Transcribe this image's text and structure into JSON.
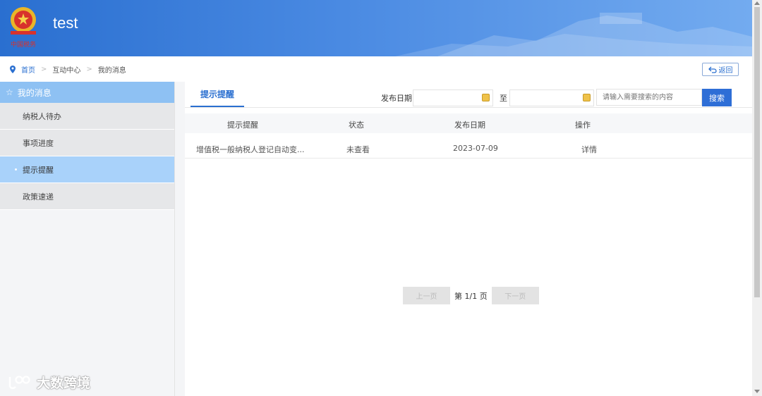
{
  "header": {
    "title": "test"
  },
  "breadcrumb": {
    "home": "首页",
    "level2": "互动中心",
    "current": "我的消息",
    "back_label": "返回"
  },
  "sidebar": {
    "title": "我的消息",
    "items": [
      {
        "label": "纳税人待办"
      },
      {
        "label": "事项进度"
      },
      {
        "label": "提示提醒"
      },
      {
        "label": "政策速递"
      }
    ]
  },
  "main": {
    "tab": "提示提醒",
    "filter": {
      "date_label": "发布日期",
      "to_label": "至",
      "search_placeholder": "请输入需要搜索的内容",
      "search_button": "搜索"
    },
    "table": {
      "headers": [
        "提示提醒",
        "状态",
        "发布日期",
        "操作"
      ],
      "rows": [
        {
          "title": "增值税一般纳税人登记自动变...",
          "status": "未查看",
          "date": "2023-07-09",
          "action": "详情"
        }
      ]
    },
    "pager": {
      "prev": "上一页",
      "page_info": "第 1/1 页",
      "next": "下一页"
    }
  },
  "watermark": "大数跨境",
  "colors": {
    "primary": "#2a6fd0",
    "sidebar_active": "#a9d2fa",
    "sidebar_head": "#8ec1f3"
  }
}
